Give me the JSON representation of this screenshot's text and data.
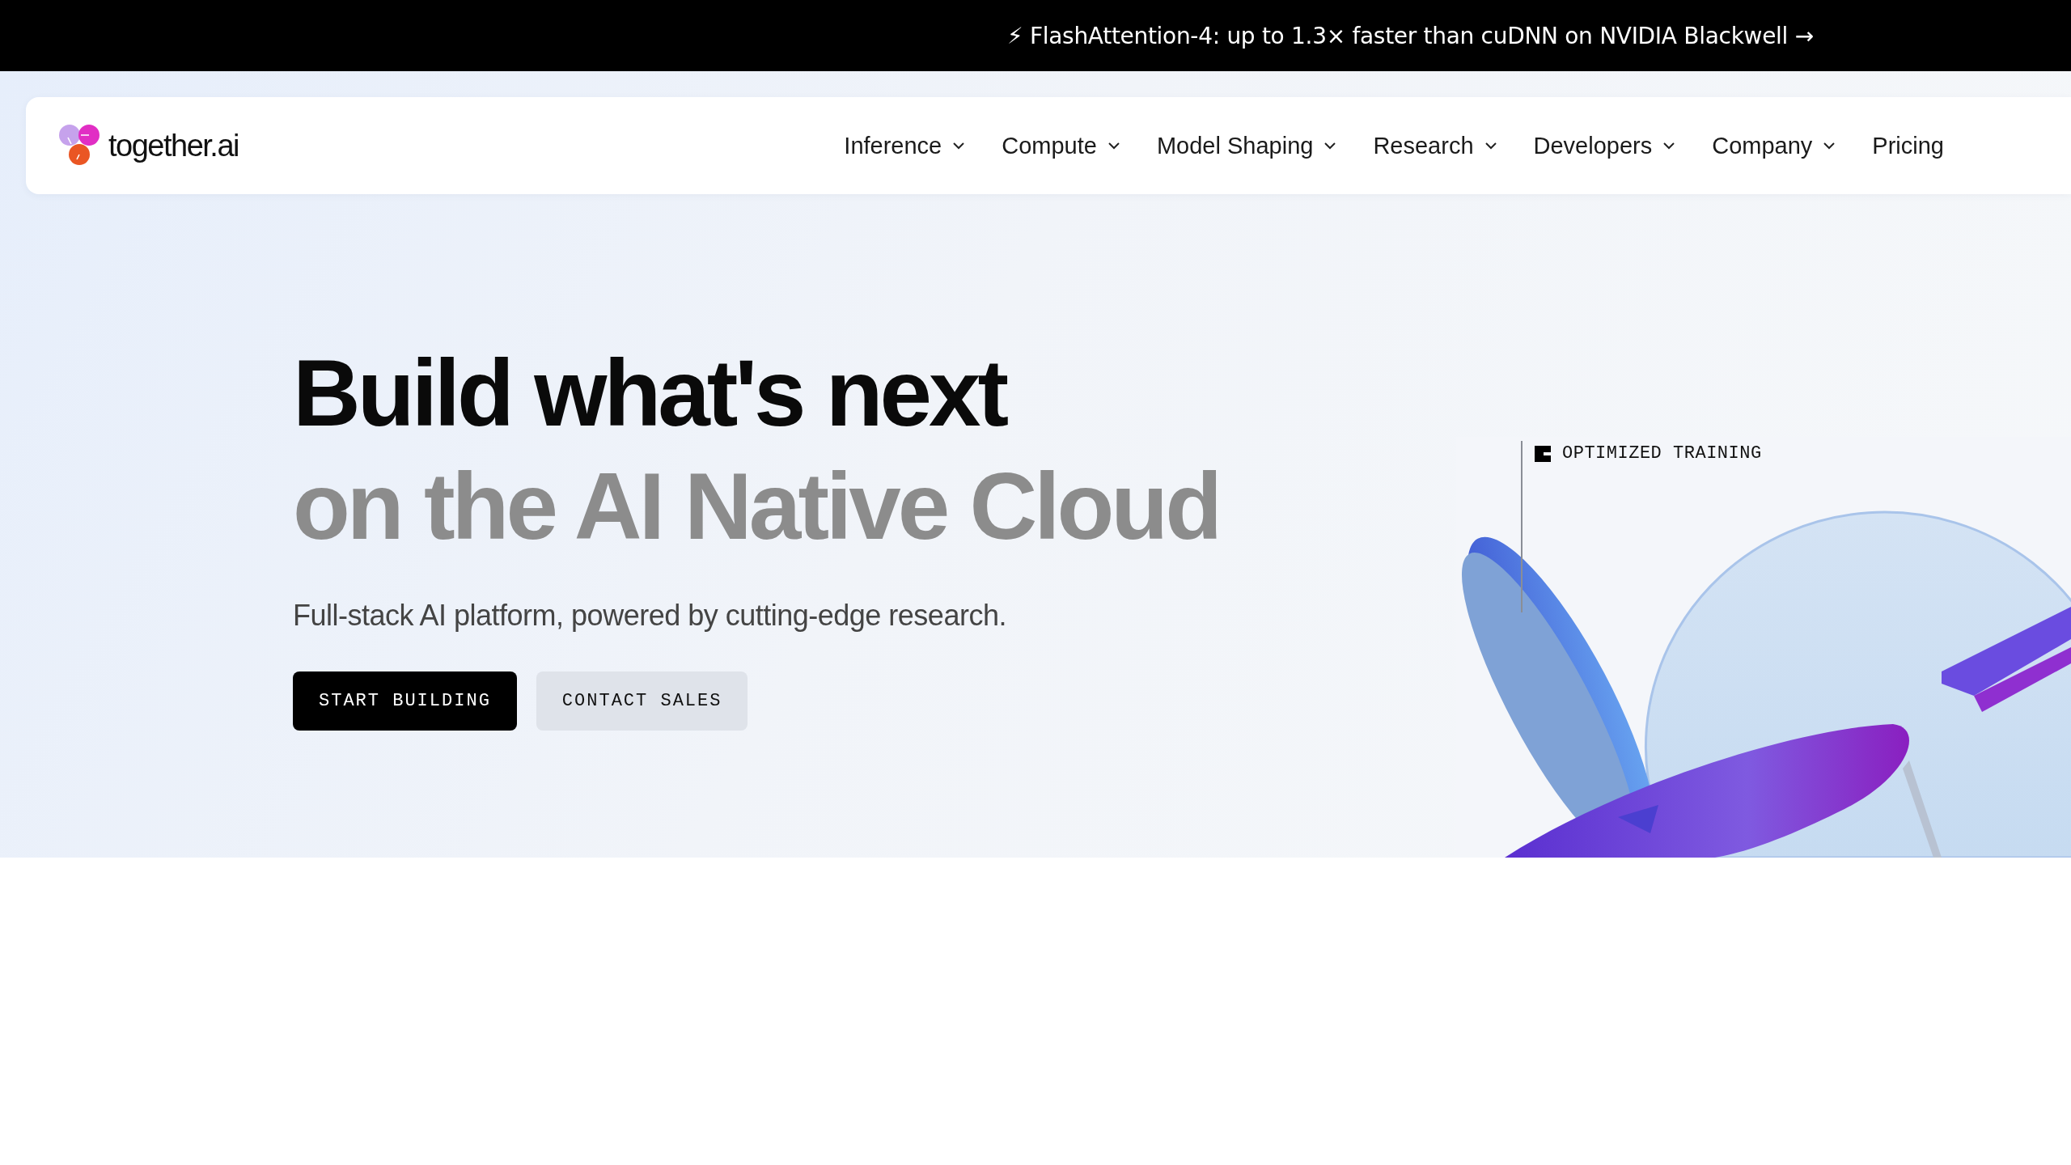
{
  "announcement": {
    "text": "⚡ FlashAttention-4: up to 1.3× faster than cuDNN on NVIDIA Blackwell →"
  },
  "nav": {
    "logo": "together.ai",
    "items": [
      {
        "label": "Inference",
        "dropdown": true
      },
      {
        "label": "Compute",
        "dropdown": true
      },
      {
        "label": "Model Shaping",
        "dropdown": true
      },
      {
        "label": "Research",
        "dropdown": true
      },
      {
        "label": "Developers",
        "dropdown": true
      },
      {
        "label": "Company",
        "dropdown": true
      },
      {
        "label": "Pricing",
        "dropdown": false
      }
    ]
  },
  "hero": {
    "headline": "Build what's next",
    "headline_continued": "on the AI Native Cloud",
    "subtitle": "Full-stack AI platform, powered by cutting-edge research.",
    "buttons": [
      {
        "label": "START BUILDING",
        "kind": "primary"
      },
      {
        "label": "CONTACT SALES",
        "kind": "secondary"
      }
    ],
    "visual": {
      "kind": "picture",
      "label": "OPTIMIZED TRAINING"
    }
  }
}
